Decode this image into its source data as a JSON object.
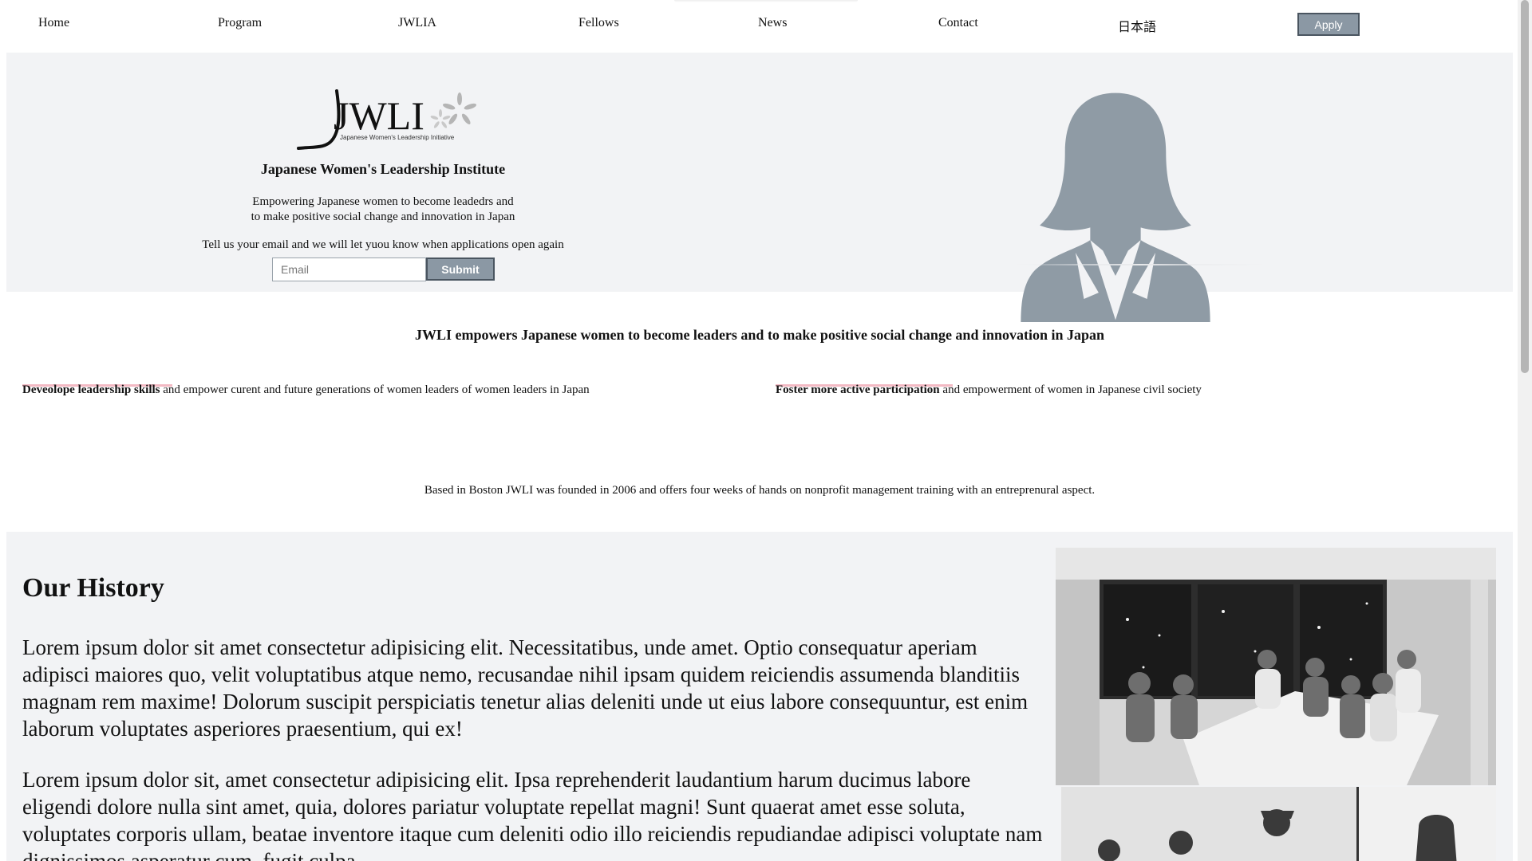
{
  "nav": {
    "items": [
      {
        "label": "Home"
      },
      {
        "label": "Program"
      },
      {
        "label": "JWLIA"
      },
      {
        "label": "Fellows"
      },
      {
        "label": "News"
      },
      {
        "label": "Contact"
      },
      {
        "label": "日本語"
      }
    ],
    "apply_label": "Apply"
  },
  "hero": {
    "logo_text": "JWLI",
    "logo_subtext": "Japanese Women's Leadership Initiative",
    "title": "Japanese Women's Leadership Institute",
    "subtitle_line1": "Empowering Japanese women to become leadedrs and",
    "subtitle_line2": "to make positive social change and innovation in Japan",
    "email_prompt": "Tell us your email and we will let yuou know when applications open again",
    "email_placeholder": "Email",
    "submit_label": "Submit"
  },
  "mission": {
    "statement": "JWLI empowers Japanese women to become leaders and to make positive social change and innovation in Japan",
    "pillars": [
      {
        "bold": "Deveolope leadership skills",
        "rest": " and empower curent and future generations of women leaders of women leaders in Japan"
      },
      {
        "bold": "Foster more active participation",
        "rest": " and empowerment of women in Japanese civil society"
      }
    ],
    "founded": "Based in Boston JWLI was founded in 2006 and offers four weeks of hands on nonprofit management training with an entreprenural aspect."
  },
  "history": {
    "title": "Our History",
    "paragraphs": [
      "Lorem ipsum dolor sit amet consectetur adipisicing elit. Necessitatibus, unde amet. Optio consequatur aperiam adipisci maiores quo, velit voluptatibus atque nemo, recusandae nihil ipsam quidem reiciendis assumenda blanditiis magnam rem maxime! Dolorum suscipit perspiciatis tenetur alias deleniti unde ut eius labore consequuntur, est enim laborum voluptates asperiores praesentium, qui ex!",
      "Lorem ipsum dolor sit, amet consectetur adipisicing elit. Ipsa reprehenderit laudantium harum ducimus labore eligendi dolore nulla sint amet, quia, dolores pariatur voluptate repellat magni! Sunt quaerat amet esse soluta, voluptates corporis ullam, beatae inventore itaque cum deleniti odio illo reiciendis repudiandae adipisci voluptate nam dignissimos asperatur cum, fugit culpa."
    ]
  },
  "colors": {
    "accent_button": "#8b98a4",
    "hero_background": "#f2f3f5",
    "pillar_underline": "#f3b9c3",
    "avatar": "#8f9ba5"
  }
}
